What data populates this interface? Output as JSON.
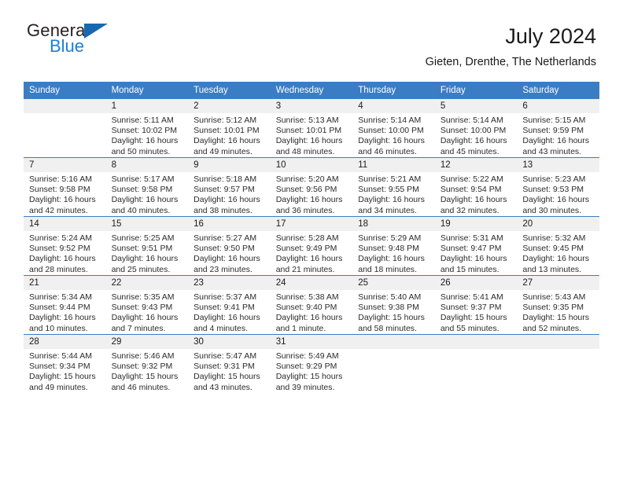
{
  "brand": {
    "name_part1": "General",
    "name_part2": "Blue",
    "triangle_color": "#1768b0",
    "blue": "#1a7fd4"
  },
  "header": {
    "title": "July 2024",
    "subtitle": "Gieten, Drenthe, The Netherlands"
  },
  "theme": {
    "header_bar": "#3b7dc4",
    "daynum_strip": "#f0f0f0",
    "grid_line": "#3b7dc4"
  },
  "weekdays": [
    "Sunday",
    "Monday",
    "Tuesday",
    "Wednesday",
    "Thursday",
    "Friday",
    "Saturday"
  ],
  "weeks": [
    [
      {
        "day": "",
        "empty": true,
        "sunrise": "",
        "sunset": "",
        "daylight1": "",
        "daylight2": ""
      },
      {
        "day": "1",
        "sunrise": "Sunrise: 5:11 AM",
        "sunset": "Sunset: 10:02 PM",
        "daylight1": "Daylight: 16 hours",
        "daylight2": "and 50 minutes."
      },
      {
        "day": "2",
        "sunrise": "Sunrise: 5:12 AM",
        "sunset": "Sunset: 10:01 PM",
        "daylight1": "Daylight: 16 hours",
        "daylight2": "and 49 minutes."
      },
      {
        "day": "3",
        "sunrise": "Sunrise: 5:13 AM",
        "sunset": "Sunset: 10:01 PM",
        "daylight1": "Daylight: 16 hours",
        "daylight2": "and 48 minutes."
      },
      {
        "day": "4",
        "sunrise": "Sunrise: 5:14 AM",
        "sunset": "Sunset: 10:00 PM",
        "daylight1": "Daylight: 16 hours",
        "daylight2": "and 46 minutes."
      },
      {
        "day": "5",
        "sunrise": "Sunrise: 5:14 AM",
        "sunset": "Sunset: 10:00 PM",
        "daylight1": "Daylight: 16 hours",
        "daylight2": "and 45 minutes."
      },
      {
        "day": "6",
        "sunrise": "Sunrise: 5:15 AM",
        "sunset": "Sunset: 9:59 PM",
        "daylight1": "Daylight: 16 hours",
        "daylight2": "and 43 minutes."
      }
    ],
    [
      {
        "day": "7",
        "sunrise": "Sunrise: 5:16 AM",
        "sunset": "Sunset: 9:58 PM",
        "daylight1": "Daylight: 16 hours",
        "daylight2": "and 42 minutes."
      },
      {
        "day": "8",
        "sunrise": "Sunrise: 5:17 AM",
        "sunset": "Sunset: 9:58 PM",
        "daylight1": "Daylight: 16 hours",
        "daylight2": "and 40 minutes."
      },
      {
        "day": "9",
        "sunrise": "Sunrise: 5:18 AM",
        "sunset": "Sunset: 9:57 PM",
        "daylight1": "Daylight: 16 hours",
        "daylight2": "and 38 minutes."
      },
      {
        "day": "10",
        "sunrise": "Sunrise: 5:20 AM",
        "sunset": "Sunset: 9:56 PM",
        "daylight1": "Daylight: 16 hours",
        "daylight2": "and 36 minutes."
      },
      {
        "day": "11",
        "sunrise": "Sunrise: 5:21 AM",
        "sunset": "Sunset: 9:55 PM",
        "daylight1": "Daylight: 16 hours",
        "daylight2": "and 34 minutes."
      },
      {
        "day": "12",
        "sunrise": "Sunrise: 5:22 AM",
        "sunset": "Sunset: 9:54 PM",
        "daylight1": "Daylight: 16 hours",
        "daylight2": "and 32 minutes."
      },
      {
        "day": "13",
        "sunrise": "Sunrise: 5:23 AM",
        "sunset": "Sunset: 9:53 PM",
        "daylight1": "Daylight: 16 hours",
        "daylight2": "and 30 minutes."
      }
    ],
    [
      {
        "day": "14",
        "sunrise": "Sunrise: 5:24 AM",
        "sunset": "Sunset: 9:52 PM",
        "daylight1": "Daylight: 16 hours",
        "daylight2": "and 28 minutes."
      },
      {
        "day": "15",
        "sunrise": "Sunrise: 5:25 AM",
        "sunset": "Sunset: 9:51 PM",
        "daylight1": "Daylight: 16 hours",
        "daylight2": "and 25 minutes."
      },
      {
        "day": "16",
        "sunrise": "Sunrise: 5:27 AM",
        "sunset": "Sunset: 9:50 PM",
        "daylight1": "Daylight: 16 hours",
        "daylight2": "and 23 minutes."
      },
      {
        "day": "17",
        "sunrise": "Sunrise: 5:28 AM",
        "sunset": "Sunset: 9:49 PM",
        "daylight1": "Daylight: 16 hours",
        "daylight2": "and 21 minutes."
      },
      {
        "day": "18",
        "sunrise": "Sunrise: 5:29 AM",
        "sunset": "Sunset: 9:48 PM",
        "daylight1": "Daylight: 16 hours",
        "daylight2": "and 18 minutes."
      },
      {
        "day": "19",
        "sunrise": "Sunrise: 5:31 AM",
        "sunset": "Sunset: 9:47 PM",
        "daylight1": "Daylight: 16 hours",
        "daylight2": "and 15 minutes."
      },
      {
        "day": "20",
        "sunrise": "Sunrise: 5:32 AM",
        "sunset": "Sunset: 9:45 PM",
        "daylight1": "Daylight: 16 hours",
        "daylight2": "and 13 minutes."
      }
    ],
    [
      {
        "day": "21",
        "sunrise": "Sunrise: 5:34 AM",
        "sunset": "Sunset: 9:44 PM",
        "daylight1": "Daylight: 16 hours",
        "daylight2": "and 10 minutes."
      },
      {
        "day": "22",
        "sunrise": "Sunrise: 5:35 AM",
        "sunset": "Sunset: 9:43 PM",
        "daylight1": "Daylight: 16 hours",
        "daylight2": "and 7 minutes."
      },
      {
        "day": "23",
        "sunrise": "Sunrise: 5:37 AM",
        "sunset": "Sunset: 9:41 PM",
        "daylight1": "Daylight: 16 hours",
        "daylight2": "and 4 minutes."
      },
      {
        "day": "24",
        "sunrise": "Sunrise: 5:38 AM",
        "sunset": "Sunset: 9:40 PM",
        "daylight1": "Daylight: 16 hours",
        "daylight2": "and 1 minute."
      },
      {
        "day": "25",
        "sunrise": "Sunrise: 5:40 AM",
        "sunset": "Sunset: 9:38 PM",
        "daylight1": "Daylight: 15 hours",
        "daylight2": "and 58 minutes."
      },
      {
        "day": "26",
        "sunrise": "Sunrise: 5:41 AM",
        "sunset": "Sunset: 9:37 PM",
        "daylight1": "Daylight: 15 hours",
        "daylight2": "and 55 minutes."
      },
      {
        "day": "27",
        "sunrise": "Sunrise: 5:43 AM",
        "sunset": "Sunset: 9:35 PM",
        "daylight1": "Daylight: 15 hours",
        "daylight2": "and 52 minutes."
      }
    ],
    [
      {
        "day": "28",
        "sunrise": "Sunrise: 5:44 AM",
        "sunset": "Sunset: 9:34 PM",
        "daylight1": "Daylight: 15 hours",
        "daylight2": "and 49 minutes."
      },
      {
        "day": "29",
        "sunrise": "Sunrise: 5:46 AM",
        "sunset": "Sunset: 9:32 PM",
        "daylight1": "Daylight: 15 hours",
        "daylight2": "and 46 minutes."
      },
      {
        "day": "30",
        "sunrise": "Sunrise: 5:47 AM",
        "sunset": "Sunset: 9:31 PM",
        "daylight1": "Daylight: 15 hours",
        "daylight2": "and 43 minutes."
      },
      {
        "day": "31",
        "sunrise": "Sunrise: 5:49 AM",
        "sunset": "Sunset: 9:29 PM",
        "daylight1": "Daylight: 15 hours",
        "daylight2": "and 39 minutes."
      },
      {
        "day": "",
        "empty": true,
        "sunrise": "",
        "sunset": "",
        "daylight1": "",
        "daylight2": ""
      },
      {
        "day": "",
        "empty": true,
        "sunrise": "",
        "sunset": "",
        "daylight1": "",
        "daylight2": ""
      },
      {
        "day": "",
        "empty": true,
        "sunrise": "",
        "sunset": "",
        "daylight1": "",
        "daylight2": ""
      }
    ]
  ]
}
